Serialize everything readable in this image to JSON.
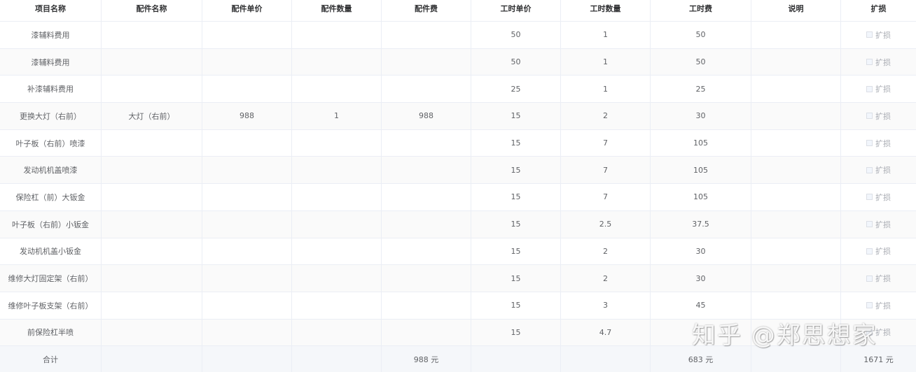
{
  "table": {
    "headers": [
      "项目名称",
      "配件名称",
      "配件单价",
      "配件数量",
      "配件费",
      "工时单价",
      "工时数量",
      "工时费",
      "说明",
      "扩损"
    ],
    "checkbox_label": "扩损",
    "rows": [
      {
        "item": "漆辅料费用",
        "part": "",
        "part_price": "",
        "part_qty": "",
        "part_fee": "",
        "labor_price": "50",
        "labor_qty": "1",
        "labor_fee": "50",
        "note": ""
      },
      {
        "item": "漆辅料费用",
        "part": "",
        "part_price": "",
        "part_qty": "",
        "part_fee": "",
        "labor_price": "50",
        "labor_qty": "1",
        "labor_fee": "50",
        "note": ""
      },
      {
        "item": "补漆辅料费用",
        "part": "",
        "part_price": "",
        "part_qty": "",
        "part_fee": "",
        "labor_price": "25",
        "labor_qty": "1",
        "labor_fee": "25",
        "note": ""
      },
      {
        "item": "更换大灯（右前）",
        "part": "大灯（右前）",
        "part_price": "988",
        "part_qty": "1",
        "part_fee": "988",
        "labor_price": "15",
        "labor_qty": "2",
        "labor_fee": "30",
        "note": ""
      },
      {
        "item": "叶子板（右前）喷漆",
        "part": "",
        "part_price": "",
        "part_qty": "",
        "part_fee": "",
        "labor_price": "15",
        "labor_qty": "7",
        "labor_fee": "105",
        "note": ""
      },
      {
        "item": "发动机机盖喷漆",
        "part": "",
        "part_price": "",
        "part_qty": "",
        "part_fee": "",
        "labor_price": "15",
        "labor_qty": "7",
        "labor_fee": "105",
        "note": ""
      },
      {
        "item": "保险杠（前）大钣金",
        "part": "",
        "part_price": "",
        "part_qty": "",
        "part_fee": "",
        "labor_price": "15",
        "labor_qty": "7",
        "labor_fee": "105",
        "note": ""
      },
      {
        "item": "叶子板（右前）小钣金",
        "part": "",
        "part_price": "",
        "part_qty": "",
        "part_fee": "",
        "labor_price": "15",
        "labor_qty": "2.5",
        "labor_fee": "37.5",
        "note": ""
      },
      {
        "item": "发动机机盖小钣金",
        "part": "",
        "part_price": "",
        "part_qty": "",
        "part_fee": "",
        "labor_price": "15",
        "labor_qty": "2",
        "labor_fee": "30",
        "note": ""
      },
      {
        "item": "维修大灯固定架（右前）",
        "part": "",
        "part_price": "",
        "part_qty": "",
        "part_fee": "",
        "labor_price": "15",
        "labor_qty": "2",
        "labor_fee": "30",
        "note": ""
      },
      {
        "item": "维修叶子板支架（右前）",
        "part": "",
        "part_price": "",
        "part_qty": "",
        "part_fee": "",
        "labor_price": "15",
        "labor_qty": "3",
        "labor_fee": "45",
        "note": ""
      },
      {
        "item": "前保险杠半喷",
        "part": "",
        "part_price": "",
        "part_qty": "",
        "part_fee": "",
        "labor_price": "15",
        "labor_qty": "4.7",
        "labor_fee": "",
        "note": ""
      }
    ],
    "footer": {
      "label": "合计",
      "part_fee_total": "988 元",
      "labor_fee_total": "683 元",
      "grand_total": "1671 元"
    }
  },
  "watermark": "知乎 @郑思想家"
}
